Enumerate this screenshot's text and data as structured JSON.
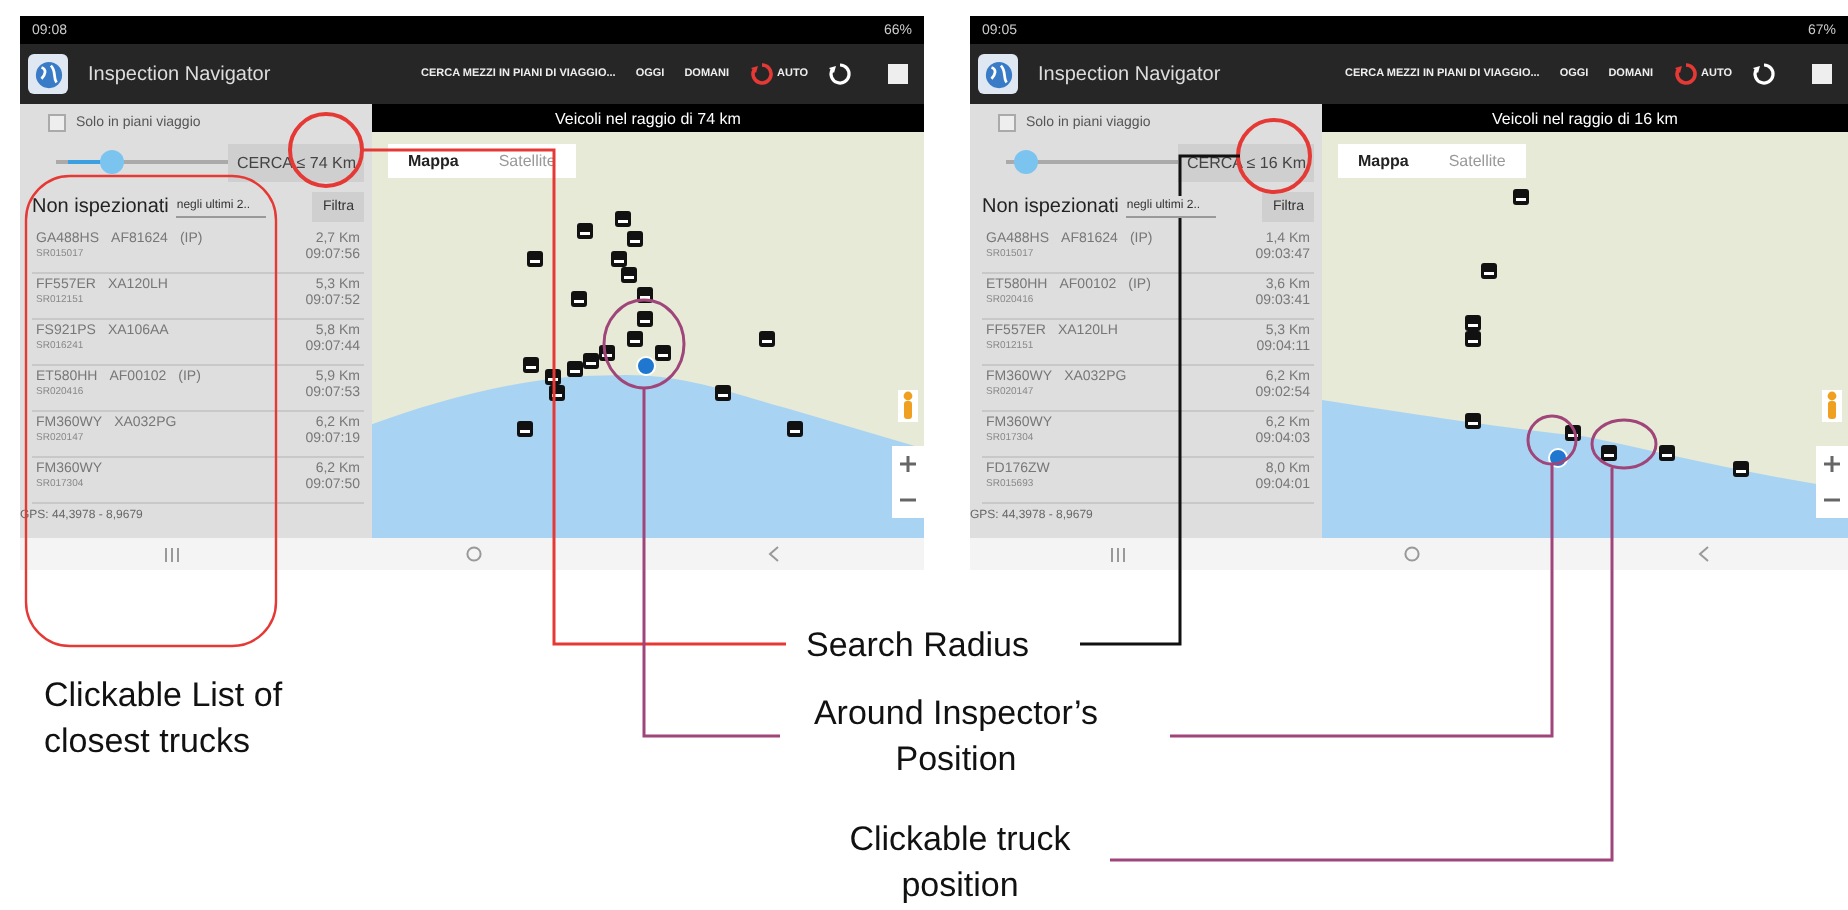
{
  "screens": [
    {
      "status_bar": {
        "time": "09:08",
        "battery": "66%"
      },
      "app_bar": {
        "title": "Inspection Navigator",
        "actions": [
          "CERCA MEZZI IN PIANI DI VIAGGIO...",
          "OGGI",
          "DOMANI"
        ],
        "auto": "AUTO"
      },
      "panel": {
        "checkbox": {
          "label": "Solo in piani viaggio",
          "checked": false
        },
        "slider": {
          "level": 0.3
        },
        "search_button": "CERCA ≤ 74 Km",
        "filter": {
          "label": "Non ispezionati",
          "dropdown": "negli ultimi 2..",
          "button": "Filtra"
        },
        "trucks": [
          {
            "plate": "GA488HS",
            "trailer": "AF81624",
            "tag": "(IP)",
            "code": "SR015017",
            "distance": "2,7 Km",
            "time": "09:07:56"
          },
          {
            "plate": "FF557ER",
            "trailer": "XA120LH",
            "code": "SR012151",
            "distance": "5,3 Km",
            "time": "09:07:52"
          },
          {
            "plate": "FS921PS",
            "trailer": "XA106AA",
            "code": "SR016241",
            "distance": "5,8 Km",
            "time": "09:07:44"
          },
          {
            "plate": "ET580HH",
            "trailer": "AF00102",
            "tag": "(IP)",
            "code": "SR020416",
            "distance": "5,9 Km",
            "time": "09:07:53"
          },
          {
            "plate": "FM360WY",
            "trailer": "XA032PG",
            "code": "SR020147",
            "distance": "6,2 Km",
            "time": "09:07:19"
          },
          {
            "plate": "FM360WY",
            "code": "SR017304",
            "distance": "6,2 Km",
            "time": "09:07:50"
          }
        ],
        "gps": "GPS: 44,3978 - 8,9679"
      },
      "map": {
        "header": "Veicoli nel raggio di 74 km",
        "tabs": [
          {
            "label": "Mappa",
            "selected": true
          },
          {
            "label": "Satellite",
            "selected": false
          }
        ]
      }
    },
    {
      "status_bar": {
        "time": "09:05",
        "battery": "67%"
      },
      "app_bar": {
        "title": "Inspection Navigator",
        "actions": [
          "CERCA MEZZI IN PIANI DI VIAGGIO...",
          "OGGI",
          "DOMANI"
        ],
        "auto": "AUTO"
      },
      "panel": {
        "checkbox": {
          "label": "Solo in piani viaggio",
          "checked": false
        },
        "slider": {
          "level": 0.05
        },
        "search_button": "CERCA ≤ 16 Km",
        "filter": {
          "label": "Non ispezionati",
          "dropdown": "negli ultimi 2..",
          "button": "Filtra"
        },
        "trucks": [
          {
            "plate": "GA488HS",
            "trailer": "AF81624",
            "tag": "(IP)",
            "code": "SR015017",
            "distance": "1,4 Km",
            "time": "09:03:47"
          },
          {
            "plate": "ET580HH",
            "trailer": "AF00102",
            "tag": "(IP)",
            "code": "SR020416",
            "distance": "3,6 Km",
            "time": "09:03:41"
          },
          {
            "plate": "FF557ER",
            "trailer": "XA120LH",
            "code": "SR012151",
            "distance": "5,3 Km",
            "time": "09:04:11"
          },
          {
            "plate": "FM360WY",
            "trailer": "XA032PG",
            "code": "SR020147",
            "distance": "6,2 Km",
            "time": "09:02:54"
          },
          {
            "plate": "FM360WY",
            "code": "SR017304",
            "distance": "6,2 Km",
            "time": "09:04:03"
          },
          {
            "plate": "FD176ZW",
            "code": "SR015693",
            "distance": "8,0 Km",
            "time": "09:04:01"
          }
        ],
        "gps": "GPS: 44,3978 - 8,9679"
      },
      "map": {
        "header": "Veicoli nel raggio di 16 km",
        "tabs": [
          {
            "label": "Mappa",
            "selected": true
          },
          {
            "label": "Satellite",
            "selected": false
          }
        ]
      }
    }
  ],
  "annotations": [
    {
      "kind": "list",
      "text": "Clickable List of closest trucks"
    },
    {
      "kind": "radius",
      "text": "Search Radius"
    },
    {
      "kind": "position",
      "text": "Around Inspector’s Position"
    },
    {
      "kind": "truck",
      "text": "Clickable truck position"
    }
  ]
}
